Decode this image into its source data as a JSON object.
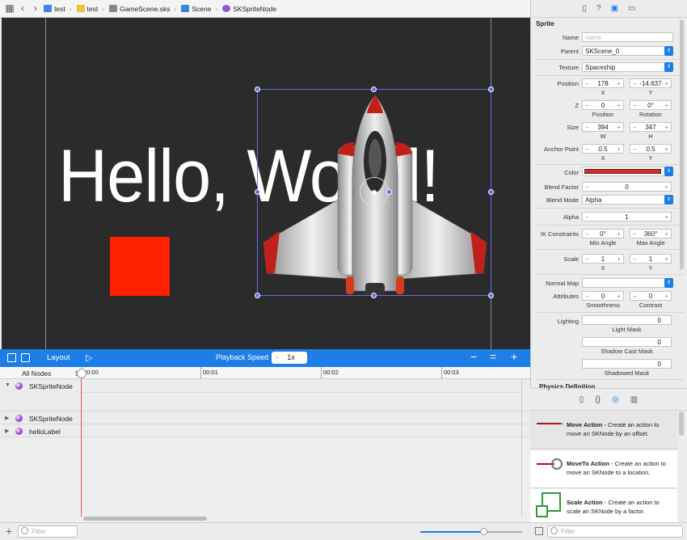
{
  "breadcrumb": [
    "test",
    "test",
    "GameScene.sks",
    "Scene",
    "SKSpriteNode"
  ],
  "scene": {
    "hello_text": "Hello, World!"
  },
  "timeline": {
    "layout_label": "Layout",
    "playback_label": "Playback Speed",
    "speed": "1x",
    "all_nodes": "All Nodes",
    "ticks": [
      "00:00",
      "00:01",
      "00:02",
      "00:03"
    ],
    "rows": [
      "SKSpriteNode",
      "SKSpriteNode",
      "helloLabel"
    ],
    "filter_placeholder": "Filter"
  },
  "inspector": {
    "section": "Sprite",
    "name_label": "Name",
    "name_placeholder": "name",
    "parent_label": "Parent",
    "parent_value": "SKScene_0",
    "texture_label": "Texture",
    "texture_value": "Spaceship",
    "position_label": "Position",
    "pos_x": "178",
    "pos_y": "-14.637",
    "x": "X",
    "y": "Y",
    "z_label": "Z",
    "z_pos": "0",
    "z_rot": "0°",
    "z_sub1": "Position",
    "z_sub2": "Rotation",
    "size_label": "Size",
    "size_w": "394",
    "size_h": "347",
    "w": "W",
    "h": "H",
    "anchor_label": "Anchor Point",
    "anchor_x": "0.5",
    "anchor_y": "0.5",
    "color_label": "Color",
    "color_value": "#e8271c",
    "blend_factor_label": "Blend Factor",
    "blend_factor": "0",
    "blend_mode_label": "Blend Mode",
    "blend_mode": "Alpha",
    "alpha_label": "Alpha",
    "alpha": "1",
    "ik_label": "IK Constraints",
    "ik_min": "0°",
    "ik_max": "360°",
    "ik_sub1": "Min Angle",
    "ik_sub2": "Max Angle",
    "scale_label": "Scale",
    "scale_x": "1",
    "scale_y": "1",
    "normal_label": "Normal Map",
    "attr_label": "Attributes",
    "attr_s": "0",
    "attr_c": "0",
    "attr_sub1": "Smoothness",
    "attr_sub2": "Contrast",
    "lighting_label": "Lighting",
    "light_mask": "0",
    "light_mask_label": "Light Mask",
    "shadow_cast": "0",
    "shadow_cast_label": "Shadow Cast Mask",
    "shadowed": "0",
    "shadowed_label": "Shadowed Mask",
    "physics": "Physics Definition"
  },
  "library": [
    {
      "title": "Move Action",
      "desc": " - Create an action to move an SKNode by an offset."
    },
    {
      "title": "MoveTo Action",
      "desc": " - Create an action to move an SKNode to a location."
    },
    {
      "title": "Scale Action",
      "desc": " - Create an action to scale an SKNode by a factor."
    }
  ],
  "library_filter": "Filter"
}
